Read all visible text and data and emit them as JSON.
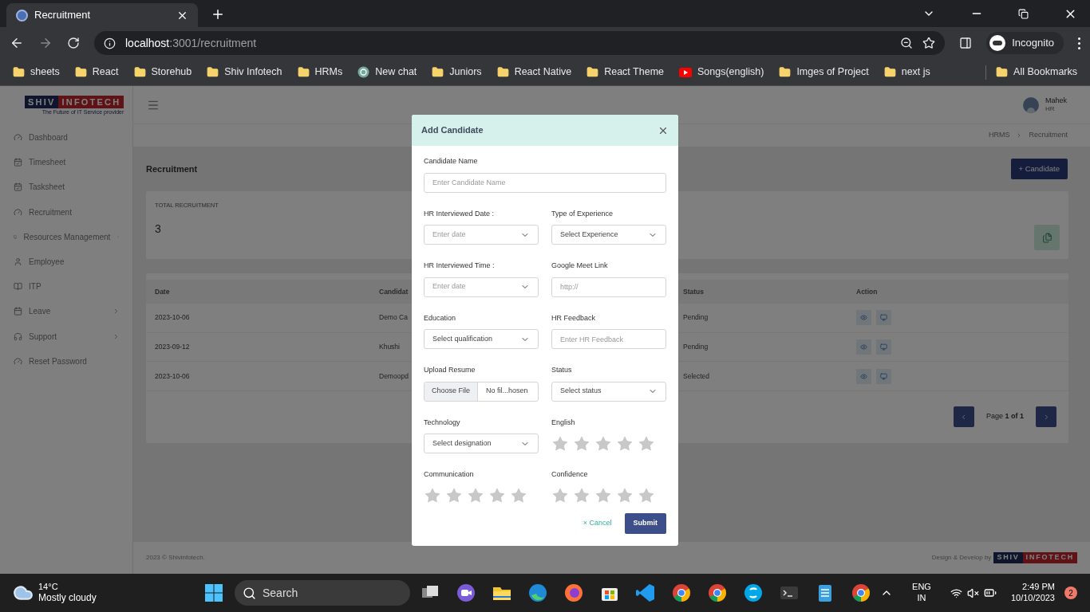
{
  "browser": {
    "tab_title": "Recruitment",
    "url_host": "localhost",
    "url_path": ":3001/recruitment",
    "profile": "Incognito",
    "bookmarks": [
      {
        "label": "sheets",
        "kind": "folder"
      },
      {
        "label": "React",
        "kind": "folder"
      },
      {
        "label": "Storehub",
        "kind": "folder"
      },
      {
        "label": "Shiv Infotech",
        "kind": "folder"
      },
      {
        "label": "HRMs",
        "kind": "folder"
      },
      {
        "label": "New chat",
        "kind": "chat"
      },
      {
        "label": "Juniors",
        "kind": "folder"
      },
      {
        "label": "React Native",
        "kind": "folder"
      },
      {
        "label": "React Theme",
        "kind": "folder"
      },
      {
        "label": "Songs(english)",
        "kind": "video"
      },
      {
        "label": "Imges of Project",
        "kind": "folder"
      },
      {
        "label": "next js",
        "kind": "folder"
      }
    ],
    "all_bookmarks": "All Bookmarks"
  },
  "logo": {
    "part1": "SHIV",
    "part2": "INFOTECH",
    "tagline": "The Future of IT Service provider"
  },
  "sidebar": {
    "items": [
      {
        "label": "Dashboard",
        "submenu": false
      },
      {
        "label": "Timesheet",
        "submenu": false
      },
      {
        "label": "Tasksheet",
        "submenu": false
      },
      {
        "label": "Recruitment",
        "submenu": false
      },
      {
        "label": "Resources Management",
        "submenu": true
      },
      {
        "label": "Employee",
        "submenu": false
      },
      {
        "label": "ITP",
        "submenu": false
      },
      {
        "label": "Leave",
        "submenu": true
      },
      {
        "label": "Support",
        "submenu": true
      },
      {
        "label": "Reset Password",
        "submenu": false
      }
    ]
  },
  "header": {
    "user_name": "Mahek",
    "user_role": "HR",
    "breadcrumb": [
      "HRMS",
      "Recruitment"
    ]
  },
  "page": {
    "title": "Recruitment",
    "add_button": "+ Candidate",
    "stat_label": "TOTAL RECRUITMENT",
    "stat_value": "3"
  },
  "table": {
    "columns": [
      "Date",
      "Candidat",
      "Status",
      "Action"
    ],
    "rows": [
      {
        "date": "2023-10-06",
        "candidate": "Demo Ca",
        "status": "Pending"
      },
      {
        "date": "2023-09-12",
        "candidate": "Khushi",
        "status": "Pending"
      },
      {
        "date": "2023-10-06",
        "candidate": "Demoopd",
        "status": "Selected"
      }
    ],
    "pagination": {
      "prefix": "Page ",
      "current": "1 of 1"
    }
  },
  "footer": {
    "copyright": "2023 © Shivinfotech.",
    "credit": "Design & Develop by",
    "logo_part1": "SHIV",
    "logo_part2": "INFOTECH"
  },
  "modal": {
    "title": "Add Candidate",
    "fields": [
      {
        "label": "Candidate Name",
        "kind": "text",
        "placeholder": "Enter Candidate Name",
        "full": true
      },
      {
        "label": "HR Interviewed Date :",
        "kind": "date",
        "placeholder": "Enter date"
      },
      {
        "label": "Type of Experience",
        "kind": "select",
        "value": "Select Experience"
      },
      {
        "label": "HR Interviewed Time :",
        "kind": "date",
        "placeholder": "Enter date"
      },
      {
        "label": "Google Meet Link",
        "kind": "text",
        "placeholder": "http://"
      },
      {
        "label": "Education",
        "kind": "select",
        "value": "Select qualification"
      },
      {
        "label": "HR Feedback",
        "kind": "text",
        "placeholder": "Enter HR Feedback"
      },
      {
        "label": "Upload Resume",
        "kind": "file",
        "button": "Choose File",
        "value": "No fil...hosen"
      },
      {
        "label": "Status",
        "kind": "select",
        "value": "Select status"
      },
      {
        "label": "Technology",
        "kind": "select",
        "value": "Select designation"
      },
      {
        "label": "English",
        "kind": "rating",
        "stars": 0
      },
      {
        "label": "Communication",
        "kind": "rating",
        "stars": 0
      },
      {
        "label": "Confidence",
        "kind": "rating",
        "stars": 0
      }
    ],
    "cancel": "× Cancel",
    "submit": "Submit"
  },
  "taskbar": {
    "temperature": "14°C",
    "weather": "Mostly cloudy",
    "search_placeholder": "Search",
    "lang": "ENG",
    "region": "IN",
    "time": "2:49 PM",
    "date": "10/10/2023",
    "notifications": "2"
  }
}
